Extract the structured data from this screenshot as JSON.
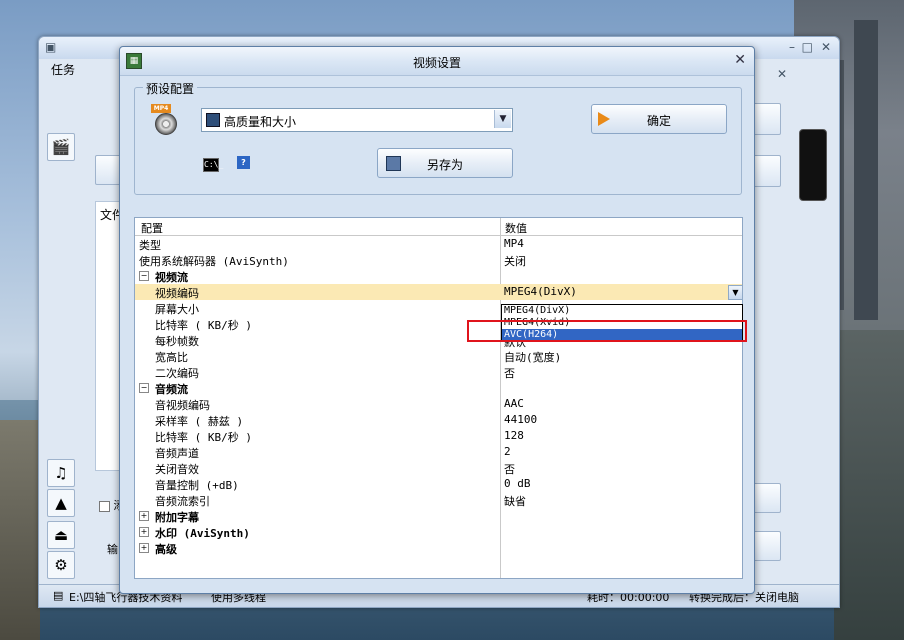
{
  "background_window": {
    "menu_tab": "任务",
    "file_column": "文件",
    "checkbox_label": "添",
    "output_label": "输",
    "status_path": "E:\\四轴飞行器技术资料",
    "status_multithread": "使用多线程",
    "status_time": "耗时：00:00:00",
    "status_after": "转换完成后：关闭电脑"
  },
  "dialog": {
    "title": "视频设置",
    "preset_group_label": "预设配置",
    "preset_value": "高质量和大小",
    "ok_label": "确定",
    "save_as_label": "另存为",
    "cmd_icon_text": "C:\\_"
  },
  "grid": {
    "col_config": "配置",
    "col_value": "数值",
    "rows": [
      {
        "key": "类型",
        "value": "MP4"
      },
      {
        "key": "使用系统解码器 (AviSynth)",
        "value": "关闭"
      },
      {
        "key": "视频流",
        "category": true
      },
      {
        "key": "视频编码",
        "value": "MPEG4(DivX)",
        "selected": true
      },
      {
        "key": "屏幕大小",
        "value": ""
      },
      {
        "key": "比特率 ( KB/秒 )",
        "value": ""
      },
      {
        "key": "每秒帧数",
        "value": "默认"
      },
      {
        "key": "宽高比",
        "value": "自动(宽度)"
      },
      {
        "key": "二次编码",
        "value": "否"
      },
      {
        "key": "音频流",
        "category": true
      },
      {
        "key": "音视频编码",
        "value": "AAC"
      },
      {
        "key": "采样率 ( 赫兹 )",
        "value": "44100"
      },
      {
        "key": "比特率 ( KB/秒 )",
        "value": "128"
      },
      {
        "key": "音频声道",
        "value": "2"
      },
      {
        "key": "关闭音效",
        "value": "否"
      },
      {
        "key": "音量控制 (+dB)",
        "value": "0 dB"
      },
      {
        "key": "音频流索引",
        "value": "缺省"
      },
      {
        "key": "附加字幕",
        "category": true,
        "collapsed": true
      },
      {
        "key": "水印 (AviSynth)",
        "category": true,
        "collapsed": true
      },
      {
        "key": "高级",
        "category": true,
        "collapsed": true
      }
    ],
    "dropdown_options": [
      "MPEG4(DivX)",
      "MPEG4(Xvid)",
      "AVC(H264)"
    ],
    "dropdown_highlight": "AVC(H264)"
  },
  "colors": {
    "highlight": "#3166c4",
    "selected_row": "#fbe9b4",
    "annotation_box": "#e0141c"
  }
}
